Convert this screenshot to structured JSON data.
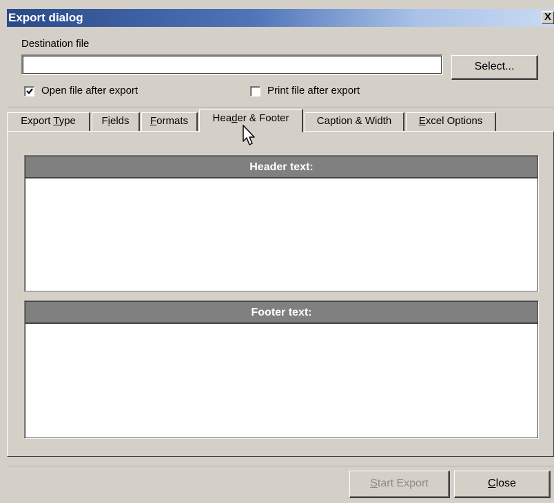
{
  "window": {
    "title": "Export dialog",
    "close_label": "X"
  },
  "destination": {
    "label": "Destination file",
    "value": "",
    "select_label": "Select..."
  },
  "options": {
    "open_after_export": {
      "label": "Open file after export",
      "checked": true
    },
    "print_after_export": {
      "label": "Print file after export",
      "checked": false
    }
  },
  "tabs": [
    {
      "pre": "Export ",
      "key": "T",
      "post": "ype",
      "active": false
    },
    {
      "pre": "F",
      "key": "i",
      "post": "elds",
      "active": false
    },
    {
      "pre": "",
      "key": "F",
      "post": "ormats",
      "active": false
    },
    {
      "pre": "Hea",
      "key": "d",
      "post": "er & Footer",
      "active": true
    },
    {
      "pre": "Caption & Width",
      "key": "",
      "post": "",
      "active": false
    },
    {
      "pre": "",
      "key": "E",
      "post": "xcel Options",
      "active": false
    }
  ],
  "header_group": {
    "title": "Header text:",
    "value": ""
  },
  "footer_group": {
    "title": "Footer text:",
    "value": ""
  },
  "footer_buttons": {
    "start_export": {
      "key": "S",
      "rest": "tart Export",
      "enabled": false
    },
    "close": {
      "key": "C",
      "rest": "lose",
      "enabled": true
    }
  },
  "icons": {
    "cursor": "arrow-cursor-icon",
    "checkmark": "checkmark-icon"
  }
}
